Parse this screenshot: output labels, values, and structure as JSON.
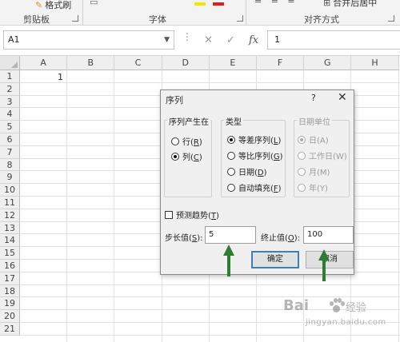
{
  "ribbon": {
    "format_painter_label": "格式刷",
    "clipboard_group": "剪贴板",
    "font_group": "字体",
    "alignment_group": "对齐方式",
    "merge_label": "合并后居中"
  },
  "formula_bar": {
    "name_box_value": "A1",
    "cancel_symbol": "✕",
    "enter_symbol": "✓",
    "fx_symbol": "fx",
    "formula_value": "1"
  },
  "sheet": {
    "columns": [
      "A",
      "B",
      "C",
      "D",
      "E",
      "F",
      "G",
      "H"
    ],
    "rows": [
      "1",
      "2",
      "3",
      "4",
      "5",
      "6",
      "7",
      "8",
      "9",
      "10",
      "11",
      "12",
      "13",
      "14",
      "15",
      "16",
      "17",
      "18",
      "19",
      "20",
      "21"
    ],
    "cell_a1": "1"
  },
  "dialog": {
    "title": "序列",
    "help": "?",
    "close": "✕",
    "series_in": {
      "legend": "序列产生在",
      "rows_label": "行(",
      "rows_key": "R",
      "cols_label": "列(",
      "cols_key": "C",
      "selected": "cols"
    },
    "type": {
      "legend": "类型",
      "linear": "等差序列(",
      "linear_key": "L",
      "growth": "等比序列(",
      "growth_key": "G",
      "date": "日期(",
      "date_key": "D",
      "autofill": "自动填充(",
      "autofill_key": "F",
      "selected": "linear"
    },
    "date_unit": {
      "legend": "日期单位",
      "day": "日(A)",
      "weekday": "工作日(W)",
      "month": "月(M)",
      "year": "年(Y)",
      "selected": "day"
    },
    "trend": {
      "label": "预测趋势(",
      "key": "T",
      "checked": false
    },
    "step": {
      "label": "步长值(",
      "key": "S",
      "suffix": "):",
      "value": "5"
    },
    "stop": {
      "label": "终止值(",
      "key": "O",
      "suffix": "):",
      "value": "100"
    },
    "ok_label": "确定",
    "cancel_label": "取消"
  },
  "annotations": {
    "arrow_color": "#2f7d32"
  },
  "watermark": {
    "brand": "Bai",
    "suffix": "经验",
    "url": "jingyan.baidu.com"
  },
  "colors": {
    "accent": "#3c7fb1",
    "header_bg": "#efefef"
  }
}
